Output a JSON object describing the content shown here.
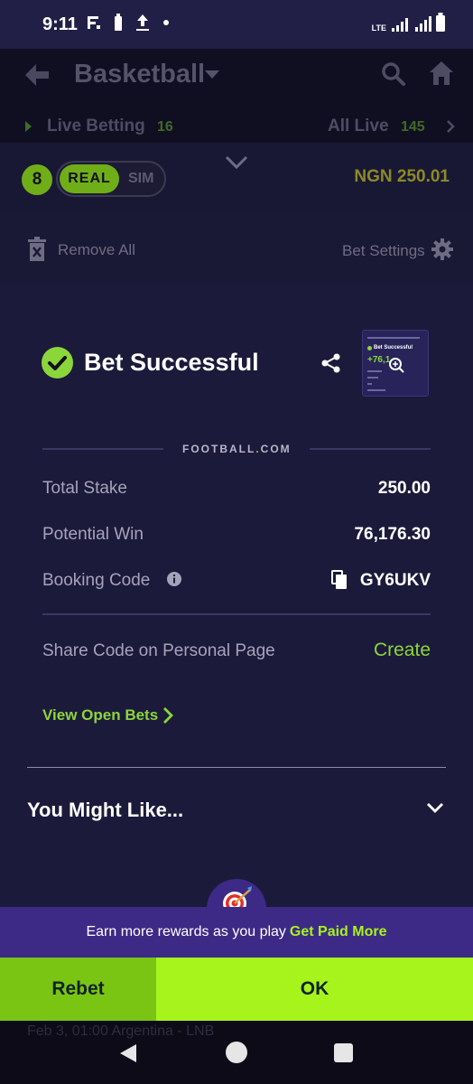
{
  "status_bar": {
    "time": "9:11",
    "network": "LTE"
  },
  "header": {
    "title": "Basketball",
    "live_betting_label": "Live Betting",
    "live_betting_count": "16",
    "all_live_label": "All Live",
    "all_live_count": "145"
  },
  "betslip": {
    "selection_count": "8",
    "mode_real": "REAL",
    "mode_sim": "SIM",
    "balance": "NGN 250.01",
    "remove_all": "Remove All",
    "bet_settings": "Bet Settings"
  },
  "result": {
    "title": "Bet Successful",
    "thumb_title": "Bet Successful",
    "thumb_value": "+76,1",
    "brand_prefix": "FOOTBALL",
    "brand_dot": ".",
    "brand_suffix": "COM",
    "total_stake_label": "Total Stake",
    "total_stake_value": "250.00",
    "potential_win_label": "Potential Win",
    "potential_win_value": "76,176.30",
    "booking_code_label": "Booking Code",
    "booking_code_value": "GY6UKV",
    "share_code_label": "Share Code on Personal Page",
    "create_label": "Create",
    "view_open_bets": "View Open Bets"
  },
  "recommendations": {
    "title": "You Might Like..."
  },
  "rewards": {
    "text": "Earn more rewards as you play",
    "link": "Get Paid More"
  },
  "buttons": {
    "rebet": "Rebet",
    "ok": "OK"
  },
  "background_text": {
    "match_info": "Feb 3, 01:00  Argentina - LNB"
  },
  "colors": {
    "accent_green": "#a6f41c",
    "success_green": "#8bd63b",
    "background": "#1c1a3a",
    "rewards_purple": "#3d2a86"
  }
}
